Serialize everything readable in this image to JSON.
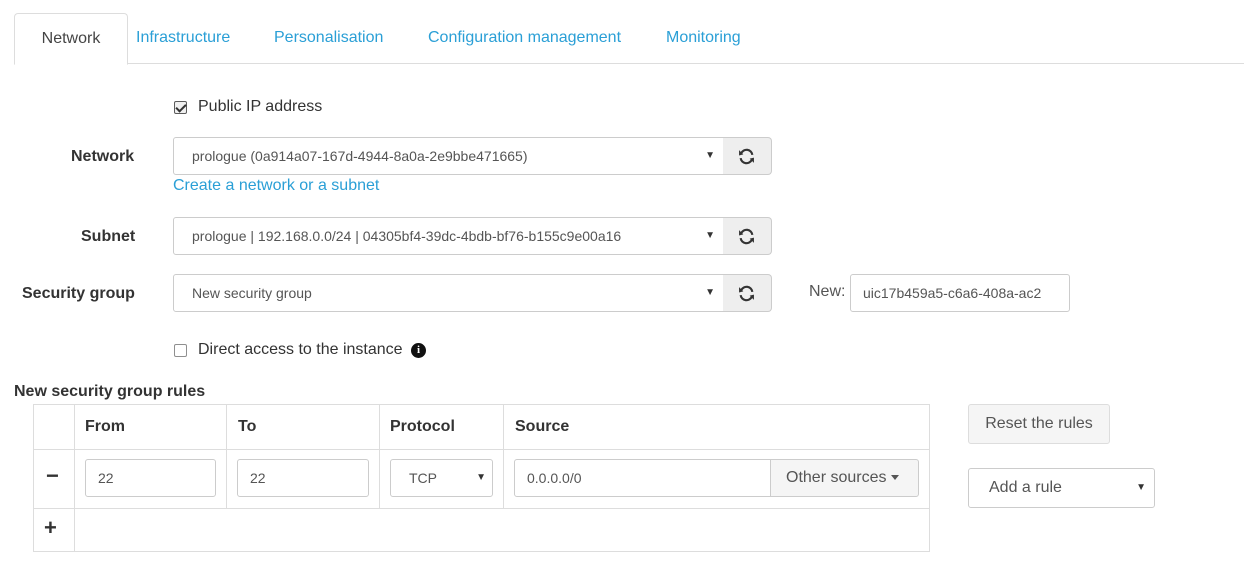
{
  "tabs": [
    {
      "label": "Network",
      "active": true
    },
    {
      "label": "Infrastructure"
    },
    {
      "label": "Personalisation"
    },
    {
      "label": "Configuration management"
    },
    {
      "label": "Monitoring"
    }
  ],
  "public_ip": {
    "label": "Public IP address",
    "checked": true
  },
  "network": {
    "label": "Network",
    "value": "prologue (0a914a07-167d-4944-8a0a-2e9bbe471665)",
    "create_link": "Create a network or a subnet"
  },
  "subnet": {
    "label": "Subnet",
    "value": "prologue | 192.168.0.0/24 | 04305bf4-39dc-4bdb-bf76-b155c9e00a16"
  },
  "security_group": {
    "label": "Security group",
    "value": "New security group",
    "new_label": "New:",
    "new_value": "uic17b459a5-c6a6-408a-ac2"
  },
  "direct_access": {
    "label": "Direct access to the instance",
    "checked": false
  },
  "rules": {
    "title": "New security group rules",
    "headers": [
      "From",
      "To",
      "Protocol",
      "Source"
    ],
    "rows": [
      {
        "from": "22",
        "to": "22",
        "protocol": "TCP",
        "source": "0.0.0.0/0",
        "other_sources": "Other sources"
      }
    ],
    "remove_symbol": "−",
    "add_symbol": "+",
    "reset_label": "Reset the rules",
    "add_rule_label": "Add a rule"
  },
  "icons": {
    "refresh": "refresh-icon",
    "info": "info-icon",
    "dropdown": "chevron-down-icon"
  },
  "colors": {
    "link": "#2a9fd6",
    "border": "#dddddd"
  }
}
